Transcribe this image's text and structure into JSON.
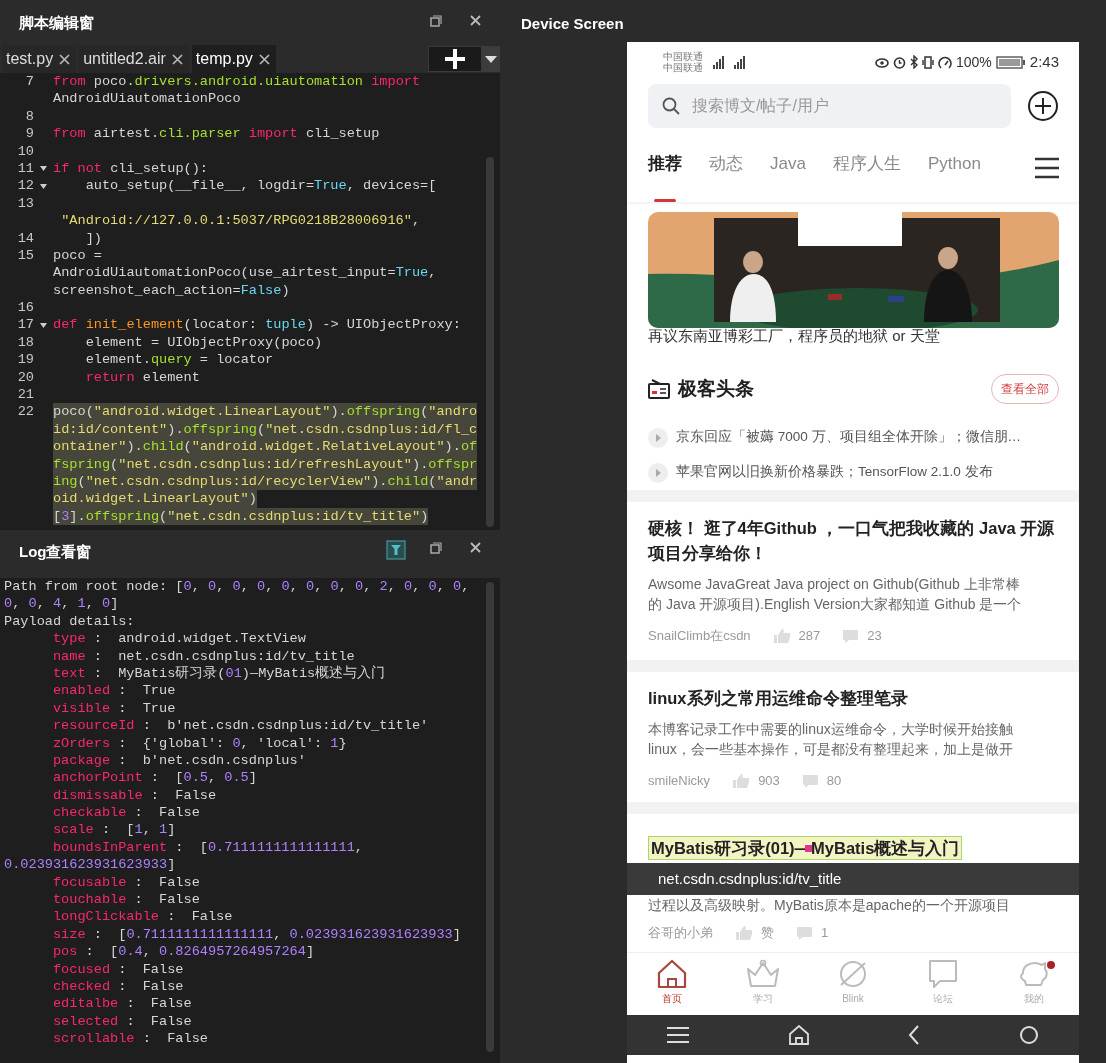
{
  "editor": {
    "title": "脚本编辑窗",
    "tabs": [
      {
        "label": "test.py",
        "selected": false
      },
      {
        "label": "untitled2.air",
        "selected": false
      },
      {
        "label": "temp.py",
        "selected": true
      }
    ],
    "rows": [
      {
        "number": "7",
        "fold": false,
        "highlight": false,
        "tokens": [
          {
            "kind": "keyword",
            "text": "from"
          },
          {
            "kind": "plain",
            "text": " poco."
          },
          {
            "kind": "module",
            "text": "drivers.android.uiautomation"
          },
          {
            "kind": "keyword",
            "text": " import"
          }
        ]
      },
      {
        "fold": false,
        "highlight": false,
        "tokens": [
          {
            "kind": "plain",
            "text": "AndroidUiautomationPoco"
          }
        ]
      },
      {
        "number": "8",
        "fold": false,
        "highlight": false,
        "tokens": []
      },
      {
        "number": "9",
        "fold": false,
        "highlight": false,
        "tokens": [
          {
            "kind": "keyword",
            "text": "from"
          },
          {
            "kind": "plain",
            "text": " airtest."
          },
          {
            "kind": "module",
            "text": "cli.parser"
          },
          {
            "kind": "keyword",
            "text": " import"
          },
          {
            "kind": "plain",
            "text": " cli_setup"
          }
        ]
      },
      {
        "number": "10",
        "fold": false,
        "highlight": false,
        "tokens": []
      },
      {
        "number": "11",
        "fold": true,
        "highlight": false,
        "tokens": [
          {
            "kind": "keyword",
            "text": "if"
          },
          {
            "kind": "keyword",
            "text": " not"
          },
          {
            "kind": "plain",
            "text": " cli_setup():"
          }
        ]
      },
      {
        "number": "12",
        "fold": true,
        "highlight": false,
        "tokens": [
          {
            "kind": "plain",
            "text": "    auto_setup(__file__, logdir="
          },
          {
            "kind": "constant",
            "text": "True"
          },
          {
            "kind": "plain",
            "text": ", devices=["
          }
        ]
      },
      {
        "number": "13",
        "fold": false,
        "highlight": false,
        "tokens": []
      },
      {
        "fold": false,
        "highlight": false,
        "tokens": [
          {
            "kind": "string",
            "text": " \"Android://127.0.0.1:5037/RPG0218B28006916\""
          },
          {
            "kind": "plain",
            "text": ","
          }
        ]
      },
      {
        "number": "14",
        "fold": false,
        "highlight": false,
        "tokens": [
          {
            "kind": "plain",
            "text": "    ])"
          }
        ]
      },
      {
        "number": "15",
        "fold": false,
        "highlight": false,
        "tokens": [
          {
            "kind": "plain",
            "text": "poco ="
          }
        ]
      },
      {
        "fold": false,
        "highlight": false,
        "tokens": [
          {
            "kind": "plain",
            "text": "AndroidUiautomationPoco(use_airtest_input="
          },
          {
            "kind": "constant",
            "text": "True"
          },
          {
            "kind": "plain",
            "text": ","
          }
        ]
      },
      {
        "fold": false,
        "highlight": false,
        "tokens": [
          {
            "kind": "plain",
            "text": "screenshot_each_action="
          },
          {
            "kind": "constant",
            "text": "False"
          },
          {
            "kind": "plain",
            "text": ")"
          }
        ]
      },
      {
        "number": "16",
        "fold": false,
        "highlight": false,
        "tokens": []
      },
      {
        "number": "17",
        "fold": true,
        "highlight": false,
        "tokens": [
          {
            "kind": "keyword",
            "text": "def"
          },
          {
            "kind": "function",
            "text": " init_element"
          },
          {
            "kind": "plain",
            "text": "(locator: "
          },
          {
            "kind": "constant",
            "text": "tuple"
          },
          {
            "kind": "plain",
            "text": ") -> UIObjectProxy:"
          }
        ]
      },
      {
        "number": "18",
        "fold": false,
        "highlight": false,
        "tokens": [
          {
            "kind": "plain",
            "text": "    element = UIObjectProxy(poco)"
          }
        ]
      },
      {
        "number": "19",
        "fold": false,
        "highlight": false,
        "tokens": [
          {
            "kind": "plain",
            "text": "    element."
          },
          {
            "kind": "module",
            "text": "query"
          },
          {
            "kind": "plain",
            "text": " = locator"
          }
        ]
      },
      {
        "number": "20",
        "fold": false,
        "highlight": false,
        "tokens": [
          {
            "kind": "keyword",
            "text": "    return"
          },
          {
            "kind": "plain",
            "text": " element"
          }
        ]
      },
      {
        "number": "21",
        "fold": false,
        "highlight": false,
        "tokens": []
      },
      {
        "number": "22",
        "fold": false,
        "highlight": true,
        "tokens": [
          {
            "kind": "plain",
            "text": "poco("
          },
          {
            "kind": "string",
            "text": "\"android.widget.LinearLayout\""
          },
          {
            "kind": "plain",
            "text": ")."
          },
          {
            "kind": "module",
            "text": "offspring"
          },
          {
            "kind": "plain",
            "text": "("
          },
          {
            "kind": "string",
            "text": "\"andro"
          }
        ]
      },
      {
        "fold": false,
        "highlight": true,
        "tokens": [
          {
            "kind": "string",
            "text": "id:id/content\""
          },
          {
            "kind": "plain",
            "text": ")."
          },
          {
            "kind": "module",
            "text": "offspring"
          },
          {
            "kind": "plain",
            "text": "("
          },
          {
            "kind": "string",
            "text": "\"net.csdn.csdnplus:id/fl_c"
          }
        ]
      },
      {
        "fold": false,
        "highlight": true,
        "tokens": [
          {
            "kind": "string",
            "text": "ontainer\""
          },
          {
            "kind": "plain",
            "text": ")."
          },
          {
            "kind": "module",
            "text": "child"
          },
          {
            "kind": "plain",
            "text": "("
          },
          {
            "kind": "string",
            "text": "\"android.widget.RelativeLayout\""
          },
          {
            "kind": "plain",
            "text": ")."
          },
          {
            "kind": "module",
            "text": "of"
          }
        ]
      },
      {
        "fold": false,
        "highlight": true,
        "tokens": [
          {
            "kind": "module",
            "text": "fspring"
          },
          {
            "kind": "plain",
            "text": "("
          },
          {
            "kind": "string",
            "text": "\"net.csdn.csdnplus:id/refreshLayout\""
          },
          {
            "kind": "plain",
            "text": ")."
          },
          {
            "kind": "module",
            "text": "offspr"
          }
        ]
      },
      {
        "fold": false,
        "highlight": true,
        "tokens": [
          {
            "kind": "module",
            "text": "ing"
          },
          {
            "kind": "plain",
            "text": "("
          },
          {
            "kind": "string",
            "text": "\"net.csdn.csdnplus:id/recyclerView\""
          },
          {
            "kind": "plain",
            "text": ")."
          },
          {
            "kind": "module",
            "text": "child"
          },
          {
            "kind": "plain",
            "text": "("
          },
          {
            "kind": "string",
            "text": "\"andr"
          }
        ]
      },
      {
        "fold": false,
        "highlight": true,
        "tokens": [
          {
            "kind": "string",
            "text": "oid.widget.LinearLayout\""
          },
          {
            "kind": "plain",
            "text": ")"
          }
        ]
      },
      {
        "fold": false,
        "highlight": true,
        "tokens": [
          {
            "kind": "plain",
            "text": "["
          },
          {
            "kind": "number",
            "text": "3"
          },
          {
            "kind": "plain",
            "text": "]."
          },
          {
            "kind": "module",
            "text": "offspring"
          },
          {
            "kind": "plain",
            "text": "("
          },
          {
            "kind": "string",
            "text": "\"net.csdn.csdnplus:id/tv_title\""
          },
          {
            "kind": "plain",
            "text": ")"
          }
        ]
      }
    ]
  },
  "log": {
    "title": "Log查看窗",
    "rows": [
      {
        "tokens": [
          {
            "kind": "plain",
            "text": "Path from root node: ["
          },
          {
            "kind": "number",
            "text": "0"
          },
          {
            "kind": "plain",
            "text": ", "
          },
          {
            "kind": "number",
            "text": "0"
          },
          {
            "kind": "plain",
            "text": ", "
          },
          {
            "kind": "number",
            "text": "0"
          },
          {
            "kind": "plain",
            "text": ", "
          },
          {
            "kind": "number",
            "text": "0"
          },
          {
            "kind": "plain",
            "text": ", "
          },
          {
            "kind": "number",
            "text": "0"
          },
          {
            "kind": "plain",
            "text": ", "
          },
          {
            "kind": "number",
            "text": "0"
          },
          {
            "kind": "plain",
            "text": ", "
          },
          {
            "kind": "number",
            "text": "0"
          },
          {
            "kind": "plain",
            "text": ", "
          },
          {
            "kind": "number",
            "text": "0"
          },
          {
            "kind": "plain",
            "text": ", "
          },
          {
            "kind": "number",
            "text": "2"
          },
          {
            "kind": "plain",
            "text": ", "
          },
          {
            "kind": "number",
            "text": "0"
          },
          {
            "kind": "plain",
            "text": ", "
          },
          {
            "kind": "number",
            "text": "0"
          },
          {
            "kind": "plain",
            "text": ", "
          },
          {
            "kind": "number",
            "text": "0"
          },
          {
            "kind": "plain",
            "text": ","
          }
        ]
      },
      {
        "tokens": [
          {
            "kind": "number",
            "text": "0"
          },
          {
            "kind": "plain",
            "text": ", "
          },
          {
            "kind": "number",
            "text": "0"
          },
          {
            "kind": "plain",
            "text": ", "
          },
          {
            "kind": "number",
            "text": "4"
          },
          {
            "kind": "plain",
            "text": ", "
          },
          {
            "kind": "number",
            "text": "1"
          },
          {
            "kind": "plain",
            "text": ", "
          },
          {
            "kind": "number",
            "text": "0"
          },
          {
            "kind": "plain",
            "text": "]"
          }
        ]
      },
      {
        "tokens": [
          {
            "kind": "plain",
            "text": "Payload details:"
          }
        ]
      },
      {
        "tokens": [
          {
            "kind": "key",
            "text": "      type"
          },
          {
            "kind": "plain",
            "text": " :  android.widget.TextView"
          }
        ]
      },
      {
        "tokens": [
          {
            "kind": "key",
            "text": "      name"
          },
          {
            "kind": "plain",
            "text": " :  net.csdn.csdnplus:id/tv_title"
          }
        ]
      },
      {
        "tokens": [
          {
            "kind": "key",
            "text": "      text"
          },
          {
            "kind": "plain",
            "text": " :  MyBatis研习录("
          },
          {
            "kind": "number",
            "text": "01"
          },
          {
            "kind": "plain",
            "text": ")—MyBatis概述与入门"
          }
        ]
      },
      {
        "tokens": [
          {
            "kind": "key",
            "text": "      enabled"
          },
          {
            "kind": "plain",
            "text": " :  True"
          }
        ]
      },
      {
        "tokens": [
          {
            "kind": "key",
            "text": "      visible"
          },
          {
            "kind": "plain",
            "text": " :  True"
          }
        ]
      },
      {
        "tokens": [
          {
            "kind": "key",
            "text": "      resourceId"
          },
          {
            "kind": "plain",
            "text": " :  b'net.csdn.csdnplus:id/tv_title'"
          }
        ]
      },
      {
        "tokens": [
          {
            "kind": "key",
            "text": "      zOrders"
          },
          {
            "kind": "plain",
            "text": " :  {'global': "
          },
          {
            "kind": "number",
            "text": "0"
          },
          {
            "kind": "plain",
            "text": ", 'local': "
          },
          {
            "kind": "number",
            "text": "1"
          },
          {
            "kind": "plain",
            "text": "}"
          }
        ]
      },
      {
        "tokens": [
          {
            "kind": "key",
            "text": "      package"
          },
          {
            "kind": "plain",
            "text": " :  b'net.csdn.csdnplus'"
          }
        ]
      },
      {
        "tokens": [
          {
            "kind": "key",
            "text": "      anchorPoint"
          },
          {
            "kind": "plain",
            "text": " :  ["
          },
          {
            "kind": "number",
            "text": "0.5"
          },
          {
            "kind": "plain",
            "text": ", "
          },
          {
            "kind": "number",
            "text": "0.5"
          },
          {
            "kind": "plain",
            "text": "]"
          }
        ]
      },
      {
        "tokens": [
          {
            "kind": "key",
            "text": "      dismissable"
          },
          {
            "kind": "plain",
            "text": " :  False"
          }
        ]
      },
      {
        "tokens": [
          {
            "kind": "key",
            "text": "      checkable"
          },
          {
            "kind": "plain",
            "text": " :  False"
          }
        ]
      },
      {
        "tokens": [
          {
            "kind": "key",
            "text": "      scale"
          },
          {
            "kind": "plain",
            "text": " :  ["
          },
          {
            "kind": "number",
            "text": "1"
          },
          {
            "kind": "plain",
            "text": ", "
          },
          {
            "kind": "number",
            "text": "1"
          },
          {
            "kind": "plain",
            "text": "]"
          }
        ]
      },
      {
        "tokens": [
          {
            "kind": "key",
            "text": "      boundsInParent"
          },
          {
            "kind": "plain",
            "text": " :  ["
          },
          {
            "kind": "number",
            "text": "0.7111111111111111"
          },
          {
            "kind": "plain",
            "text": ","
          }
        ]
      },
      {
        "tokens": [
          {
            "kind": "number",
            "text": "0.023931623931623933"
          },
          {
            "kind": "plain",
            "text": "]"
          }
        ]
      },
      {
        "tokens": [
          {
            "kind": "key",
            "text": "      focusable"
          },
          {
            "kind": "plain",
            "text": " :  False"
          }
        ]
      },
      {
        "tokens": [
          {
            "kind": "key",
            "text": "      touchable"
          },
          {
            "kind": "plain",
            "text": " :  False"
          }
        ]
      },
      {
        "tokens": [
          {
            "kind": "key",
            "text": "      longClickable"
          },
          {
            "kind": "plain",
            "text": " :  False"
          }
        ]
      },
      {
        "tokens": [
          {
            "kind": "key",
            "text": "      size"
          },
          {
            "kind": "plain",
            "text": " :  ["
          },
          {
            "kind": "number",
            "text": "0.7111111111111111"
          },
          {
            "kind": "plain",
            "text": ", "
          },
          {
            "kind": "number",
            "text": "0.023931623931623933"
          },
          {
            "kind": "plain",
            "text": "]"
          }
        ]
      },
      {
        "tokens": [
          {
            "kind": "key",
            "text": "      pos"
          },
          {
            "kind": "plain",
            "text": " :  ["
          },
          {
            "kind": "number",
            "text": "0.4"
          },
          {
            "kind": "plain",
            "text": ", "
          },
          {
            "kind": "number",
            "text": "0.8264957264957264"
          },
          {
            "kind": "plain",
            "text": "]"
          }
        ]
      },
      {
        "tokens": [
          {
            "kind": "key",
            "text": "      focused"
          },
          {
            "kind": "plain",
            "text": " :  False"
          }
        ]
      },
      {
        "tokens": [
          {
            "kind": "key",
            "text": "      checked"
          },
          {
            "kind": "plain",
            "text": " :  False"
          }
        ]
      },
      {
        "tokens": [
          {
            "kind": "key",
            "text": "      editalbe"
          },
          {
            "kind": "plain",
            "text": " :  False"
          }
        ]
      },
      {
        "tokens": [
          {
            "kind": "key",
            "text": "      selected"
          },
          {
            "kind": "plain",
            "text": " :  False"
          }
        ]
      },
      {
        "tokens": [
          {
            "kind": "key",
            "text": "      scrollable"
          },
          {
            "kind": "plain",
            "text": " :  False"
          }
        ]
      }
    ]
  },
  "device": {
    "title": "Device Screen",
    "status_bar": {
      "carriers": [
        "中国联通",
        "中国联通"
      ],
      "battery": "100%",
      "time": "2:43"
    },
    "search": {
      "placeholder": "搜索博文/帖子/用户"
    },
    "tabs": [
      {
        "label": "推荐",
        "selected": true
      },
      {
        "label": "动态",
        "selected": false
      },
      {
        "label": "Java",
        "selected": false
      },
      {
        "label": "程序人生",
        "selected": false
      },
      {
        "label": "Python",
        "selected": false
      }
    ],
    "banner": {
      "kind": "picture",
      "caption": "再议东南亚博彩工厂，程序员的地狱 or 天堂"
    },
    "headlines": {
      "title": "极客头条",
      "button": "查看全部",
      "items": [
        "京东回应「被薅 7000 万、项目组全体开除」；微信朋…",
        "苹果官网以旧换新价格暴跌；TensorFlow 2.1.0 发布"
      ]
    },
    "articles": [
      {
        "title": "硬核！ 逛了4年Github ，一口气把我收藏的 Java 开源项目分享给你！",
        "highlighted": false,
        "summary": [
          "Awsome JavaGreat Java project on Github(Github 上非常棒",
          "的 Java 开源项目).English Version大家都知道 Github 是一个"
        ],
        "author": "SnailClimb在csdn",
        "likes": "287",
        "comments": "23"
      },
      {
        "title": "linux系列之常用运维命令整理笔录",
        "highlighted": false,
        "summary": [
          "本博客记录工作中需要的linux运维命令，大学时候开始接触",
          "linux，会一些基本操作，可是都没有整理起来，加上是做开"
        ],
        "author": "smileNicky",
        "likes": "903",
        "comments": "80"
      },
      {
        "title": "MyBatis研习录(01)—MyBatis概述与入门",
        "highlighted": true,
        "inspector_label": "net.csdn.csdnplus:id/tv_title",
        "summary": [
          "过程以及高级映射。MyBatis原本是apache的一个开源项目"
        ],
        "author": "谷哥的小弟",
        "likes": "赞",
        "comments": "1"
      }
    ],
    "bottom_nav": [
      {
        "label": "首页",
        "selected": true,
        "badge": false
      },
      {
        "label": "学习",
        "selected": false,
        "badge": false
      },
      {
        "label": "Blink",
        "selected": false,
        "badge": false
      },
      {
        "label": "论坛",
        "selected": false,
        "badge": false
      },
      {
        "label": "我的",
        "selected": false,
        "badge": true
      }
    ]
  }
}
